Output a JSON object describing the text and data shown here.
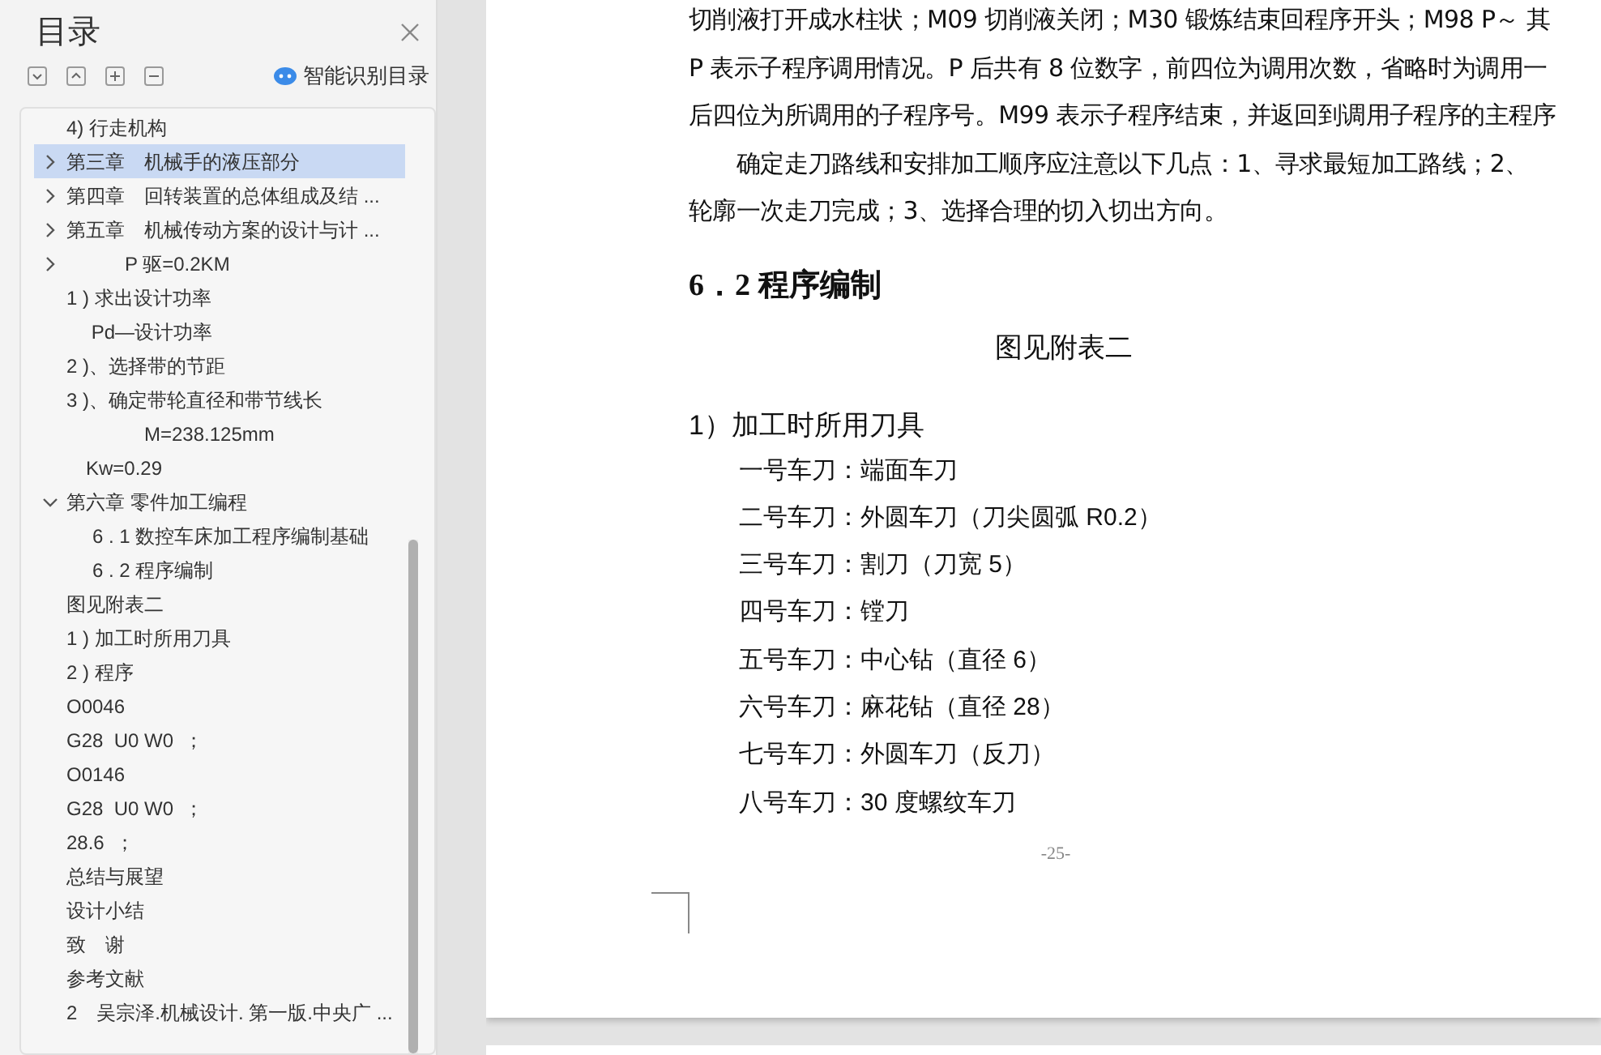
{
  "sidebar": {
    "title": "目录",
    "smart_toc_label": "智能识别目录",
    "items": [
      {
        "label": "4) 行走机构",
        "selected": false
      },
      {
        "label": "第三章　机械手的液压部分",
        "selected": true,
        "expanded": false
      },
      {
        "label": "第四章　回转装置的总体组成及结 ...",
        "selected": false,
        "expanded": false
      },
      {
        "label": "第五章　机械传动方案的设计与计 ...",
        "selected": false,
        "expanded": false
      },
      {
        "label": "　　　P 驱=0.2KM",
        "selected": false,
        "expanded": false
      },
      {
        "label": "1 ) 求出设计功率",
        "selected": false
      },
      {
        "label": "　 Pd—设计功率",
        "selected": false
      },
      {
        "label": "2 )、选择带的节距",
        "selected": false
      },
      {
        "label": "3 )、确定带轮直径和带节线长",
        "selected": false
      },
      {
        "label": "　　　　M=238.125mm",
        "selected": false
      },
      {
        "label": "　Kw=0.29",
        "selected": false
      },
      {
        "label": "第六章 零件加工编程",
        "selected": false,
        "expanded": true,
        "children": [
          {
            "label": "6 . 1 数控车床加工程序编制基础",
            "selected": false
          },
          {
            "label": "6 . 2 程序编制",
            "selected": false
          }
        ]
      },
      {
        "label": "图见附表二",
        "selected": false
      },
      {
        "label": "1 ) 加工时所用刀具",
        "selected": false
      },
      {
        "label": "2 ) 程序",
        "selected": false
      },
      {
        "label": "O0046",
        "selected": false
      },
      {
        "label": "G28  U0 W0  ；",
        "selected": false
      },
      {
        "label": "O0146",
        "selected": false
      },
      {
        "label": "G28  U0 W0  ；",
        "selected": false
      },
      {
        "label": "28.6  ；",
        "selected": false
      },
      {
        "label": "总结与展望",
        "selected": false
      },
      {
        "label": "设计小结",
        "selected": false
      },
      {
        "label": "致　谢",
        "selected": false
      },
      {
        "label": "参考文献",
        "selected": false
      },
      {
        "label": "2　吴宗泽.机械设计. 第一版.中央广 ...",
        "selected": false
      }
    ]
  },
  "document": {
    "paragraphs": [
      "切削液打开成水柱状；M09 切削液关闭；M30 锻炼结束回程序开头；M98 P～ 其",
      "P 表示子程序调用情况。P 后共有 8 位数字，前四位为调用次数，省略时为调用一",
      "后四位为所调用的子程序号。M99 表示子程序结束，并返回到调用子程序的主程序",
      "　　确定走刀路线和安排加工顺序应注意以下几点：1、寻求最短加工路线；2、",
      "轮廓一次走刀完成；3、选择合理的切入切出方向。"
    ],
    "heading": "6．2 程序编制",
    "centered_line": "图见附表二",
    "subheading": "1）加工时所用刀具",
    "tools": [
      "一号车刀：端面车刀",
      "二号车刀：外圆车刀（刀尖圆弧 R0.2）",
      "三号车刀：割刀（刀宽 5）",
      "四号车刀：镗刀",
      "五号车刀：中心钻（直径 6）",
      "六号车刀：麻花钻（直径 28）",
      "七号车刀：外圆车刀（反刀）",
      "八号车刀：30 度螺纹车刀"
    ],
    "page_number": "-25-"
  }
}
